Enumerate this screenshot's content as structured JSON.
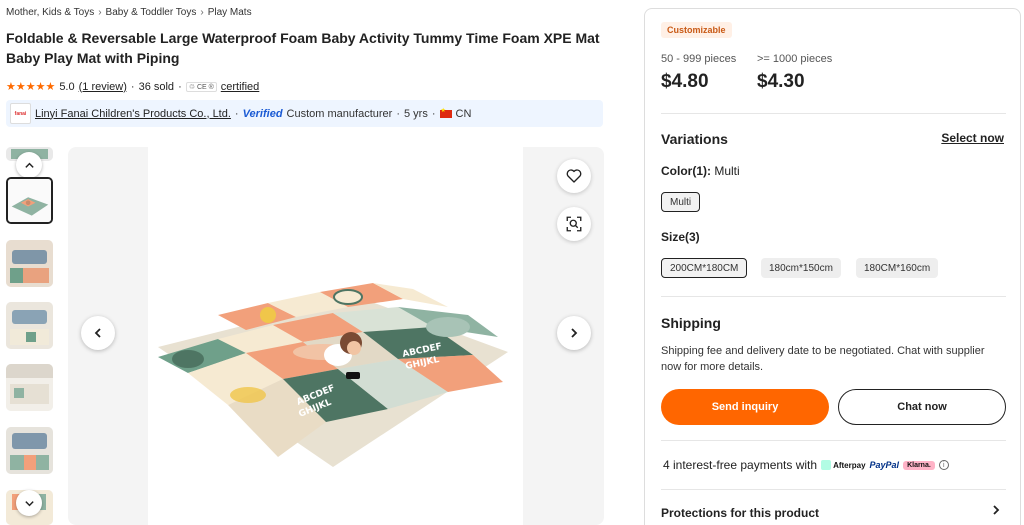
{
  "breadcrumb": [
    "Mother, Kids & Toys",
    "Baby & Toddler Toys",
    "Play Mats"
  ],
  "product": {
    "title": "Foldable & Reversable Large Waterproof Foam Baby Activity Tummy Time Foam XPE Mat Baby Play Mat with Piping",
    "rating": "5.0",
    "reviews_link": "(1 review)",
    "sold": "36 sold",
    "cert_badges": "♲ CE ®",
    "certified_link": "certified"
  },
  "supplier": {
    "name": "Linyi Fanai Children's Products Co., Ltd.",
    "verified": "Verified",
    "type": "Custom manufacturer",
    "years": "5 yrs",
    "country": "CN",
    "logo_text": "fanai"
  },
  "pricing": {
    "customizable": "Customizable",
    "tiers": [
      {
        "qty": "50 - 999 pieces",
        "price": "$4.80"
      },
      {
        "qty": ">= 1000 pieces",
        "price": "$4.30"
      }
    ]
  },
  "variations": {
    "title": "Variations",
    "select_now": "Select now",
    "color_label": "Color(1):",
    "color_value": "Multi",
    "colors": [
      "Multi"
    ],
    "size_label": "Size(3)",
    "sizes": [
      "200CM*180CM",
      "180cm*150cm",
      "180CM*160cm"
    ]
  },
  "shipping": {
    "title": "Shipping",
    "text": "Shipping fee and delivery date to be negotiated. Chat with supplier now for more details."
  },
  "actions": {
    "inquiry": "Send inquiry",
    "chat": "Chat now"
  },
  "payments": {
    "text": "4 interest-free payments with",
    "afterpay": "Afterpay",
    "paypal": "PayPal",
    "klarna": "Klarna."
  },
  "protections": "Protections for this product",
  "colors": {
    "accent": "#ff6600",
    "verified": "#1a5ad4",
    "mat_green": "#6fa08a",
    "mat_orange": "#f2a07b",
    "mat_dark": "#4e7563",
    "mat_cream": "#f5ecd8"
  }
}
